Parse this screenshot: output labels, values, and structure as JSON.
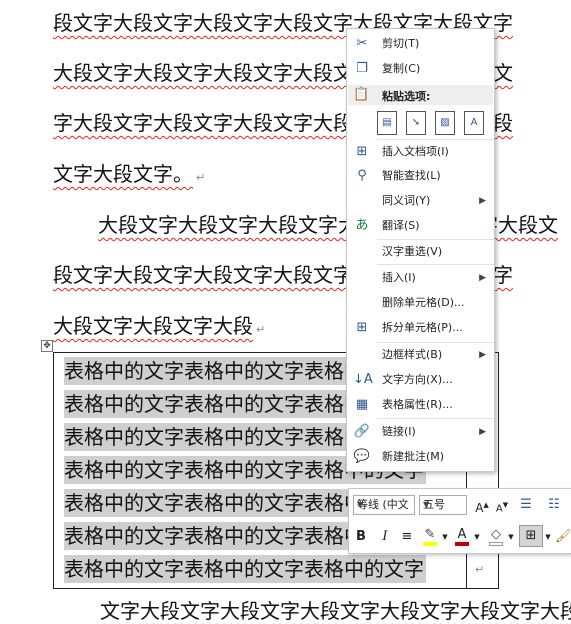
{
  "document": {
    "lines": [
      "段文字大段文字大段文字大段文字大段文字大段文字",
      "大段文字大段文字大段文字大段文字大段文字大段文",
      "字大段文字大段文字大段文字大段文字大段文字大段",
      "文字大段文字。",
      "大段文字大段文字大段文字大段文字大段文字大段文",
      "段文字大段文字大段文字大段文字大段文字大段文字",
      "大段文字大段文字大段",
      "文字大段文字大段文字大段文字大段文字大段文字大段"
    ],
    "paragraph_mark": "↵",
    "table_move_handle": "✥",
    "table_rows": [
      "表格中的文字表格中的文字表格中的文字",
      "表格中的文字表格中的文字表格中的文字",
      "表格中的文字表格中的文字表格中的文字",
      "表格中的文字表格中的文字表格中的文字",
      "表格中的文字表格中的文字表格中的文字",
      "表格中的文字表格中的文字表格中的文字",
      "表格中的文字表格中的文字表格中的文字"
    ]
  },
  "context_menu": {
    "cut": "剪切(T)",
    "copy": "复制(C)",
    "paste_options": "粘贴选项:",
    "insert_doc_item": "插入文档项(I)",
    "smart_lookup": "智能查找(L)",
    "synonyms": "同义词(Y)",
    "translate": "翻译(S)",
    "hanzi_reselect": "汉字重选(V)",
    "insert": "插入(I)",
    "delete_cells": "删除单元格(D)...",
    "split_cells": "拆分单元格(P)...",
    "border_styles": "边框样式(B)",
    "text_direction": "文字方向(X)...",
    "table_properties": "表格属性(R)...",
    "link": "链接(I)",
    "new_comment": "新建批注(M)",
    "submenu_arrow": "▶"
  },
  "mini_toolbar": {
    "font_name": "等线 (中文",
    "font_size": "五号",
    "bold": "B",
    "italic": "I",
    "align": "≡",
    "font_color_glyph": "A",
    "highlight_color": "#ffff00",
    "font_color": "#c00000"
  },
  "colors": {
    "spell_underline": "#e0261f",
    "selection": "#cfcfcf",
    "icon_blue": "#2b5797"
  }
}
